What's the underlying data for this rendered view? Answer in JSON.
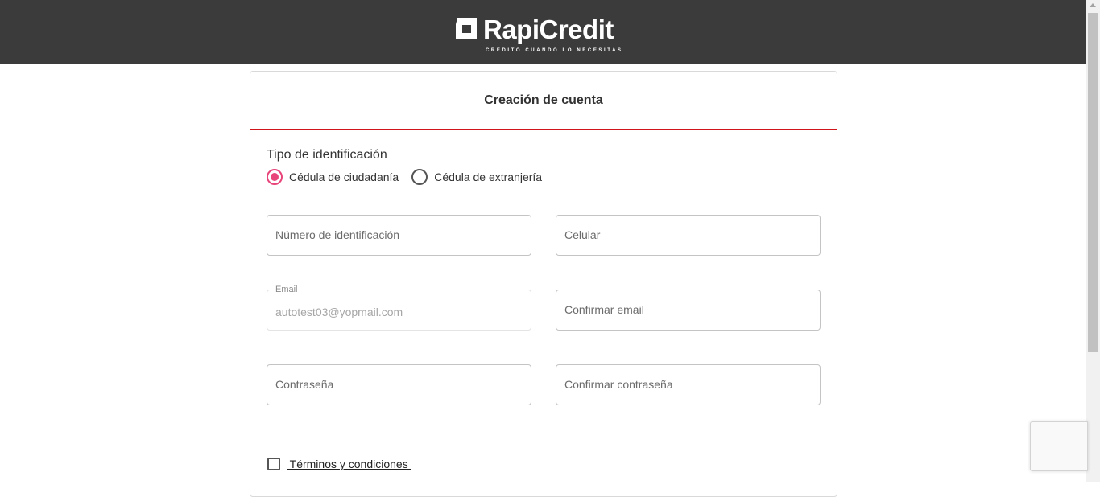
{
  "header": {
    "brand": "RapiCredit",
    "tagline": "CRÉDITO CUANDO LO NECESITAS"
  },
  "form": {
    "title": "Creación de cuenta",
    "id_type_label": "Tipo de identificación",
    "id_types": [
      {
        "label": "Cédula de ciudadanía",
        "selected": true
      },
      {
        "label": "Cédula de extranjería",
        "selected": false
      }
    ],
    "fields": {
      "id_number": {
        "placeholder": "Número de identificación"
      },
      "phone": {
        "placeholder": "Celular"
      },
      "email": {
        "label": "Email",
        "value": "autotest03@yopmail.com",
        "disabled": true
      },
      "confirm_email": {
        "placeholder": "Confirmar email"
      },
      "password": {
        "placeholder": "Contraseña"
      },
      "confirm_password": {
        "placeholder": "Confirmar contraseña"
      }
    },
    "terms_label": " Términos y condiciones ",
    "terms_checked": false
  },
  "colors": {
    "header_bg": "#3b3b3b",
    "accent_red": "#d0141b",
    "radio_pink": "#e8457a"
  },
  "icons": {
    "logo": "rapicredit-logo-icon",
    "recaptcha": "recaptcha-badge"
  }
}
